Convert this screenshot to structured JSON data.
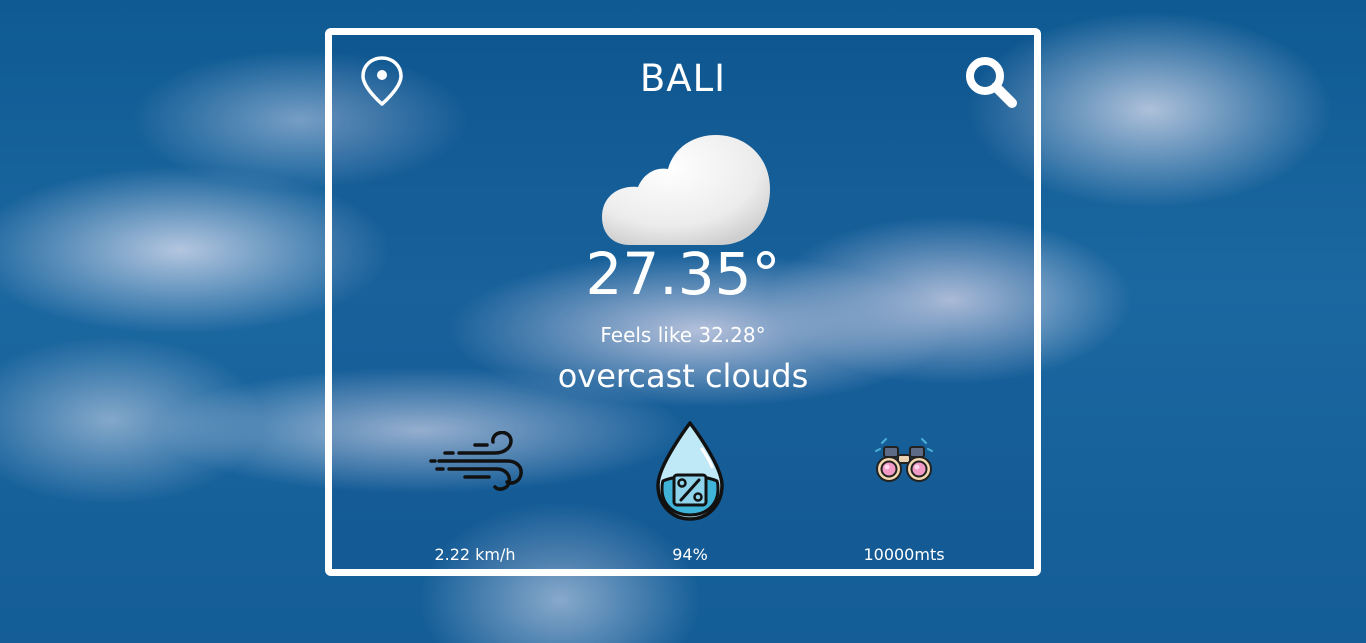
{
  "weather": {
    "city": "BALI",
    "temperature": "27.35°",
    "feels_like": "Feels like 32.28°",
    "description": "overcast clouds"
  },
  "stats": {
    "wind": {
      "icon": "wind-icon",
      "value": "2.22 km/h"
    },
    "humidity": {
      "icon": "humidity-drop-icon",
      "value": "94%"
    },
    "visibility": {
      "icon": "binoculars-icon",
      "value": "10000mts"
    }
  },
  "icons": {
    "location": "location-pin-icon",
    "search": "search-icon",
    "condition": "cloud-icon"
  },
  "colors": {
    "card_border": "#ffffff",
    "text": "#ffffff",
    "sky": "#145d97"
  }
}
